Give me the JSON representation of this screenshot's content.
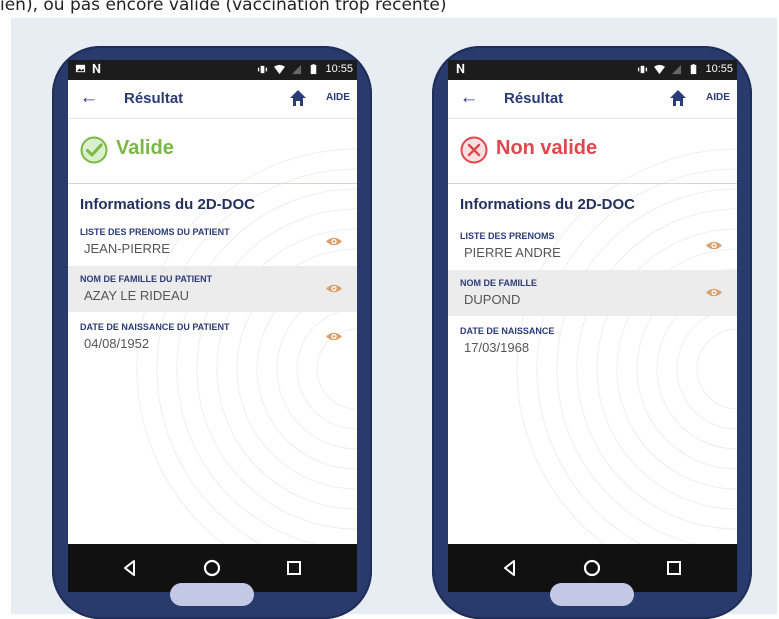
{
  "caption": "ien), ou pas encore valide (vaccination trop récente)",
  "left_phone": {
    "status_time": "10:55",
    "title": "Résultat",
    "aide": "AIDE",
    "result": "Valide",
    "result_color": "#79b844",
    "section": "Informations du 2D-DOC",
    "fields": [
      {
        "label": "LISTE DES PRENOMS DU PATIENT",
        "value": "JEAN-PIERRE"
      },
      {
        "label": "NOM DE FAMILLE DU PATIENT",
        "value": "AZAY LE RIDEAU"
      },
      {
        "label": "DATE DE NAISSANCE DU PATIENT",
        "value": "04/08/1952"
      }
    ]
  },
  "right_phone": {
    "status_time": "10:55",
    "title": "Résultat",
    "aide": "AIDE",
    "result": "Non valide",
    "result_color": "#e0474c",
    "section": "Informations du 2D-DOC",
    "fields": [
      {
        "label": "LISTE DES PRENOMS",
        "value": "PIERRE ANDRE"
      },
      {
        "label": "NOM DE FAMILLE",
        "value": "DUPOND"
      },
      {
        "label": "DATE DE NAISSANCE",
        "value": "17/03/1968"
      }
    ]
  },
  "colors": {
    "phone_body": "#293a6c",
    "primary_text": "#2a3b78",
    "eye_icon": "#d9a06b",
    "panel_bg": "#e7edf3"
  }
}
